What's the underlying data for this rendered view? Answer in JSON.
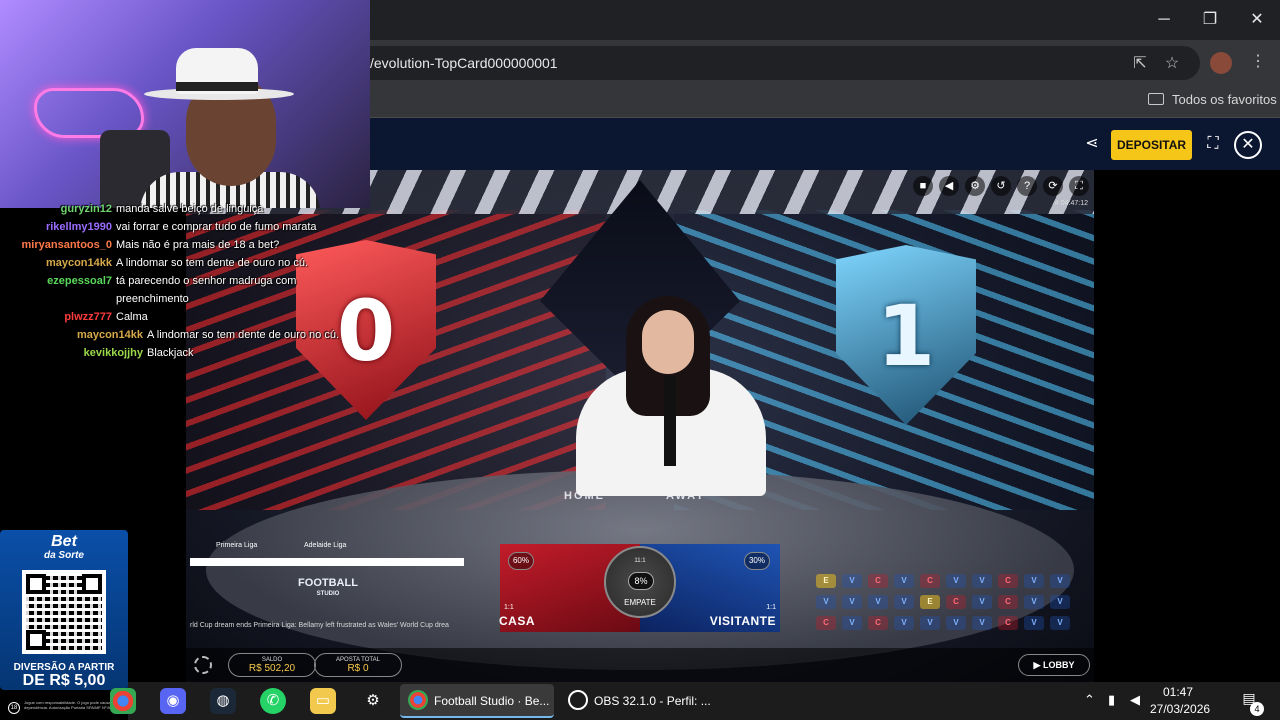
{
  "browser": {
    "url": "/evolution-TopCard000000001",
    "bookmarks_folder": "Todos os favoritos",
    "minimize": "─",
    "restore": "❐",
    "close": "✕"
  },
  "site": {
    "deposit_label": "DEPOSITAR"
  },
  "game": {
    "home_number": "0",
    "away_number": "1",
    "table_home": "HOME",
    "table_away": "AWAY",
    "game_id": "# 04:47:12",
    "logo_line1": "FOOTBALL",
    "logo_line2": "STUDIO",
    "ticker_left": "Primeira Liga",
    "ticker_right": "Adelaide Liga",
    "ticker_text": "rld Cup dream ends    Primeira Liga: Bellamy left frustrated as Wales' World Cup drea",
    "bets": {
      "home": {
        "name": "CASA",
        "pct": "60%",
        "odds": "1:1"
      },
      "tie": {
        "name": "EMPATE",
        "pct": "8%",
        "odds": "11:1"
      },
      "away": {
        "name": "VISITANTE",
        "pct": "30%",
        "odds": "1:1"
      }
    },
    "road": [
      [
        "E",
        "V",
        "C",
        "V",
        "C",
        "V",
        "V",
        "C",
        "V",
        "V"
      ],
      [
        "V",
        "V",
        "V",
        "V",
        "E",
        "C",
        "V",
        "C",
        "V",
        "V"
      ],
      [
        "C",
        "V",
        "C",
        "V",
        "V",
        "V",
        "V",
        "C",
        "V",
        "V"
      ]
    ],
    "balance_label": "SALDO",
    "balance_value": "R$ 502,20",
    "total_bet_label": "APOSTA TOTAL",
    "total_bet_value": "R$ 0",
    "lobby_label": "LOBBY",
    "colors": {
      "home": "#c41c2a",
      "away": "#1f54b4",
      "accent": "#f5c518"
    }
  },
  "chat": [
    {
      "user": "guryzin12",
      "color": "#6fd36f",
      "msg": "manda salve beiço de linguiça"
    },
    {
      "user": "rikellmy1990",
      "color": "#9a6cff",
      "msg": "vai forrar e comprar tudo de fumo marata"
    },
    {
      "user": "miryansantoos_0",
      "color": "#ff7a4a",
      "msg": "Mais não é pra mais de 18 a bet?"
    },
    {
      "user": "maycon14kk",
      "color": "#d6a94a",
      "msg": "A lindomar so tem dente de ouro no cú."
    },
    {
      "user": "ezepessoal7",
      "color": "#5ad85a",
      "msg": "tá parecendo o senhor madruga com"
    },
    {
      "user": "",
      "color": "#ffffff",
      "msg": "preenchimento"
    },
    {
      "user": "plwzz777",
      "color": "#ff3b3b",
      "msg": "Calma"
    },
    {
      "user": "maycon14kk",
      "color": "#d6a94a",
      "msg": "A lindomar so tem dente de ouro no cú."
    },
    {
      "user": "kevikkojjhy",
      "color": "#9ad84a",
      "msg": "Blackjack"
    }
  ],
  "promo": {
    "brand_line1": "Bet",
    "brand_line2": "da Sorte",
    "line1": "DIVERSÃO A PARTIR",
    "line2": "DE R$ 5,00",
    "fine_print": "Jogue com responsabilidade. O jogo pode causar dependência. Autorização Portaria SPA/MF Nº 808.",
    "age": "18"
  },
  "taskbar": {
    "apps": [
      {
        "label": "Football Studio · Be...",
        "active": true
      },
      {
        "label": "OBS 32.1.0 - Perfil: ...",
        "active": false
      }
    ],
    "time": "01:47",
    "date": "27/03/2026",
    "notifications": "4"
  }
}
